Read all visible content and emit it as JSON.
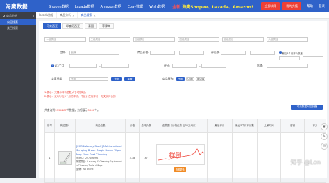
{
  "topbar": {
    "logo": "海鹰数据",
    "nav": [
      "Shopee数据",
      "Lazada数据",
      "Amazon数据",
      "Ebay数据",
      "Wish数据"
    ],
    "promo_prefix": "全新",
    "promo_main": "海鹰Shopee、Lazada、Amazon!",
    "btn_buy": "立即试用",
    "btn_recharge": "我的充值",
    "help": "帮助",
    "logout": "登录"
  },
  "sidebar": {
    "group": "商品分析",
    "items": [
      {
        "label": "商品搜索",
        "active": true
      },
      {
        "label": "类目搜索",
        "active": false
      }
    ]
  },
  "tabs": [
    {
      "label": "lazada数据",
      "active": false
    },
    {
      "label": "商品分析",
      "active": false
    },
    {
      "label": "商品搜索",
      "active": true
    }
  ],
  "subtabs": [
    {
      "label": "马来西亚",
      "active": true
    },
    {
      "label": "印度尼西亚",
      "active": false
    },
    {
      "label": "泰国",
      "active": false
    },
    {
      "label": "菲律宾",
      "active": false
    }
  ],
  "filters": {
    "cat1": "一级类目",
    "cat2": "二级类目",
    "cat3": "三级类目",
    "cat4": "四级类目",
    "cat5": "五级类目",
    "cat6": "六级类目",
    "brand_label": "品牌:",
    "brand_placeholder": "品牌",
    "price_label": "商品价格:",
    "reviews_label": "评论数:",
    "recent_label": "最近3个月评价数量:",
    "recent_prefix": "近3个月",
    "stock_label": "店铺:",
    "rating_label": "评分:",
    "seller_label": "卖家所属:",
    "seller_value": "不限",
    "sort_label": "商品筛选:",
    "btn_query": "查询",
    "btn_reset": "重置",
    "btn_all": "不限",
    "btn_china": "中国",
    "btn_non_china": "非中国"
  },
  "notice": {
    "line1": "1.提示：只展示评价总数大于0的商品",
    "line2": "2.提示：近1月/近3个月的评价，不统计仅有评分，无文字评价的"
  },
  "summary": {
    "prefix": "共查询到",
    "count": "5994487",
    "middle": "个数据，为您展示",
    "shown": "5000",
    "suffix": "个。"
  },
  "ctrl_button": "可见数据列控制器",
  "table": {
    "headers": [
      "序号",
      "商品图片",
      "商品信息",
      "价格",
      "总评价数",
      "走势图（价格走势 近30天均价）",
      "最后评价",
      "最近3个月评价数",
      "上架时间",
      "店铺",
      "评分"
    ],
    "row": {
      "index": "1",
      "title": "[ECO8&Ready Stock] Multifunctional Scraping Broom Magic Broom Wiper Mop Floor Dust Cleaning",
      "meta1": "商品ID：2274067667",
      "meta2": "所属类目：Laundry & Cleaning Equipment->Cleaning Tools->Mops",
      "meta3": "品牌：No Brand",
      "price": "5.38",
      "reviews": "37",
      "chart_button": "查看更多",
      "chart_stamp": "样例",
      "last": "",
      "recent": "",
      "date": "",
      "shop": "",
      "rating": ""
    }
  },
  "watermark": "知乎 @Lon",
  "colors": {
    "brand": "#2f62c9",
    "accent": "#ee4035",
    "sidebar": "#3c3f46"
  }
}
